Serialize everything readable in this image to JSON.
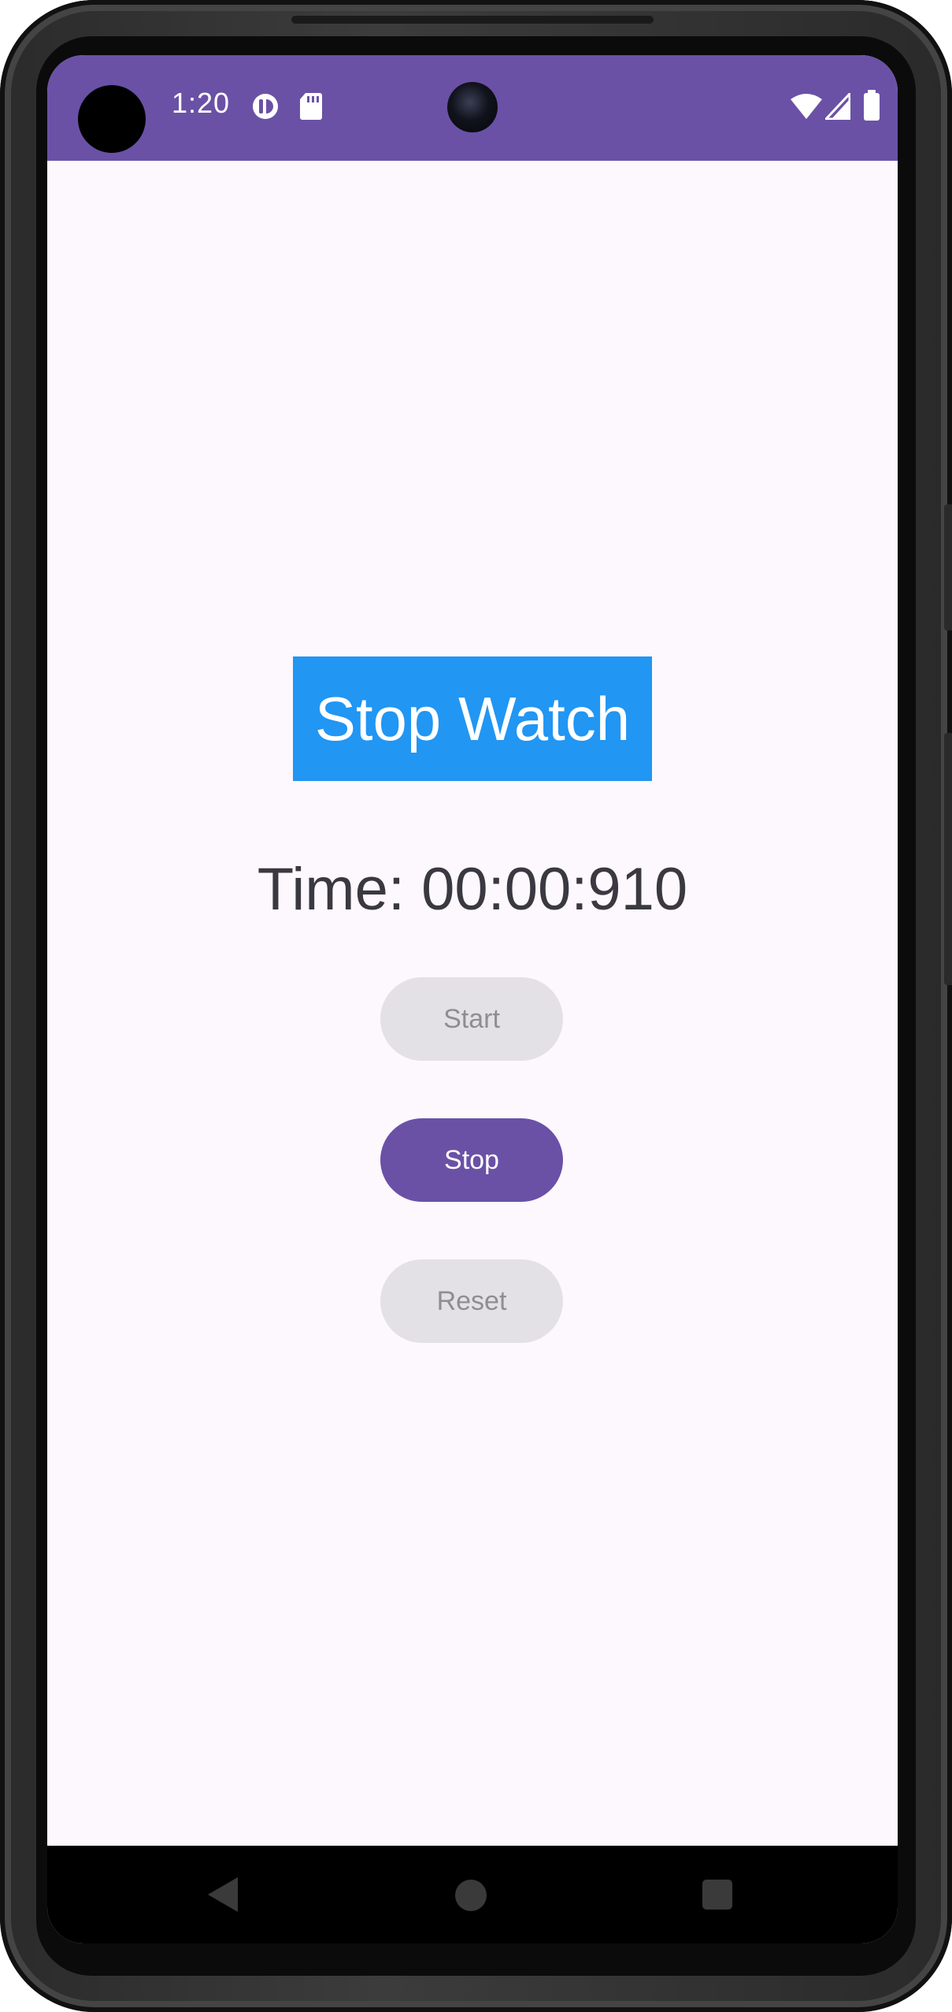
{
  "status_bar": {
    "time": "1:20",
    "background": "#6a51a6",
    "left_icons": [
      "data-saver-icon",
      "sd-card-icon"
    ],
    "right_icons": [
      "wifi-icon",
      "signal-icon",
      "battery-icon"
    ]
  },
  "app": {
    "title": "Stop Watch",
    "title_background": "#2196f3",
    "time_display": "Time: 00:00:910"
  },
  "buttons": {
    "start_label": "Start",
    "stop_label": "Stop",
    "reset_label": "Reset",
    "accent": "#6a51a6",
    "disabled_color": "#e3e1e6"
  },
  "nav_bar": {
    "icons": [
      "back-icon",
      "home-icon",
      "recents-icon"
    ]
  }
}
